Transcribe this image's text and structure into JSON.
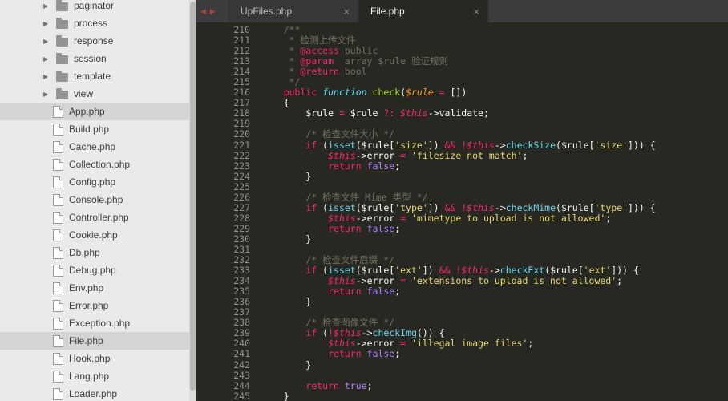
{
  "palette": {
    "editor_bg": "#272822",
    "sidebar_bg": "#eaeaea",
    "sidebar_selected_bg": "#d4d4d4",
    "tabbar_bg": "#3c3c3c",
    "comment": "#75715e",
    "keyword": "#f92672",
    "support_function": "#66d9ef",
    "function_name": "#a6e22e",
    "parameter": "#fd971f",
    "string": "#e6db74",
    "constant": "#ae81ff",
    "plain_text": "#f8f8f2",
    "line_number": "#90918b",
    "tab_arrow": "#a04848"
  },
  "icons": {
    "folder_chevron": "▶",
    "tab_prev": "◀",
    "tab_next": "▶",
    "tab_close": "×"
  },
  "sidebar": {
    "items": [
      {
        "type": "folder",
        "label": "paginator"
      },
      {
        "type": "folder",
        "label": "process"
      },
      {
        "type": "folder",
        "label": "response"
      },
      {
        "type": "folder",
        "label": "session"
      },
      {
        "type": "folder",
        "label": "template"
      },
      {
        "type": "folder",
        "label": "view"
      },
      {
        "type": "file",
        "label": "App.php",
        "selected": true
      },
      {
        "type": "file",
        "label": "Build.php"
      },
      {
        "type": "file",
        "label": "Cache.php"
      },
      {
        "type": "file",
        "label": "Collection.php"
      },
      {
        "type": "file",
        "label": "Config.php"
      },
      {
        "type": "file",
        "label": "Console.php"
      },
      {
        "type": "file",
        "label": "Controller.php"
      },
      {
        "type": "file",
        "label": "Cookie.php"
      },
      {
        "type": "file",
        "label": "Db.php"
      },
      {
        "type": "file",
        "label": "Debug.php"
      },
      {
        "type": "file",
        "label": "Env.php"
      },
      {
        "type": "file",
        "label": "Error.php"
      },
      {
        "type": "file",
        "label": "Exception.php"
      },
      {
        "type": "file",
        "label": "File.php",
        "selected": true
      },
      {
        "type": "file",
        "label": "Hook.php"
      },
      {
        "type": "file",
        "label": "Lang.php"
      },
      {
        "type": "file",
        "label": "Loader.php"
      }
    ]
  },
  "tabs": [
    {
      "label": "UpFiles.php",
      "active": false
    },
    {
      "label": "File.php",
      "active": true
    }
  ],
  "editor": {
    "first_line_number": 210,
    "last_line_number": 245,
    "lines": [
      {
        "n": 210,
        "t": [
          [
            "c",
            "    /**"
          ]
        ]
      },
      {
        "n": 211,
        "t": [
          [
            "c",
            "     * 检测上传文件"
          ]
        ]
      },
      {
        "n": 212,
        "t": [
          [
            "c",
            "     * "
          ],
          [
            "cd",
            "@access"
          ],
          [
            "c",
            " public"
          ]
        ]
      },
      {
        "n": 213,
        "t": [
          [
            "c",
            "     * "
          ],
          [
            "cd",
            "@param"
          ],
          [
            "c",
            "  array $rule 验证规则"
          ]
        ]
      },
      {
        "n": 214,
        "t": [
          [
            "c",
            "     * "
          ],
          [
            "cd",
            "@return"
          ],
          [
            "c",
            " bool"
          ]
        ]
      },
      {
        "n": 215,
        "t": [
          [
            "c",
            "     */"
          ]
        ]
      },
      {
        "n": 216,
        "t": [
          [
            "w",
            "    "
          ],
          [
            "k",
            "public"
          ],
          [
            "w",
            " "
          ],
          [
            "ki",
            "function"
          ],
          [
            "w",
            " "
          ],
          [
            "fn",
            "check"
          ],
          [
            "w",
            "("
          ],
          [
            "p",
            "$rule"
          ],
          [
            "o",
            " = "
          ],
          [
            "w",
            "[])"
          ]
        ]
      },
      {
        "n": 217,
        "t": [
          [
            "w",
            "    {"
          ]
        ]
      },
      {
        "n": 218,
        "t": [
          [
            "w",
            "        $rule"
          ],
          [
            "o",
            " = "
          ],
          [
            "w",
            "$rule"
          ],
          [
            "o",
            " ?: "
          ],
          [
            "th",
            "$this"
          ],
          [
            "w",
            "->validate;"
          ]
        ]
      },
      {
        "n": 219,
        "t": []
      },
      {
        "n": 220,
        "t": [
          [
            "c",
            "        /* 检查文件大小 */"
          ]
        ]
      },
      {
        "n": 221,
        "t": [
          [
            "w",
            "        "
          ],
          [
            "k",
            "if"
          ],
          [
            "w",
            " ("
          ],
          [
            "kc",
            "isset"
          ],
          [
            "w",
            "($rule["
          ],
          [
            "s",
            "'size'"
          ],
          [
            "w",
            "])"
          ],
          [
            "o",
            " && !"
          ],
          [
            "th",
            "$this"
          ],
          [
            "w",
            "->"
          ],
          [
            "m",
            "checkSize"
          ],
          [
            "w",
            "($rule["
          ],
          [
            "s",
            "'size'"
          ],
          [
            "w",
            "])) {"
          ]
        ]
      },
      {
        "n": 222,
        "t": [
          [
            "w",
            "            "
          ],
          [
            "th",
            "$this"
          ],
          [
            "w",
            "->error"
          ],
          [
            "o",
            " = "
          ],
          [
            "s",
            "'filesize not match'"
          ],
          [
            "w",
            ";"
          ]
        ]
      },
      {
        "n": 223,
        "t": [
          [
            "w",
            "            "
          ],
          [
            "k",
            "return"
          ],
          [
            "w",
            " "
          ],
          [
            "ct",
            "false"
          ],
          [
            "w",
            ";"
          ]
        ]
      },
      {
        "n": 224,
        "t": [
          [
            "w",
            "        }"
          ]
        ]
      },
      {
        "n": 225,
        "t": []
      },
      {
        "n": 226,
        "t": [
          [
            "c",
            "        /* 检查文件 Mime 类型 */"
          ]
        ]
      },
      {
        "n": 227,
        "t": [
          [
            "w",
            "        "
          ],
          [
            "k",
            "if"
          ],
          [
            "w",
            " ("
          ],
          [
            "kc",
            "isset"
          ],
          [
            "w",
            "($rule["
          ],
          [
            "s",
            "'type'"
          ],
          [
            "w",
            "])"
          ],
          [
            "o",
            " && !"
          ],
          [
            "th",
            "$this"
          ],
          [
            "w",
            "->"
          ],
          [
            "m",
            "checkMime"
          ],
          [
            "w",
            "($rule["
          ],
          [
            "s",
            "'type'"
          ],
          [
            "w",
            "])) {"
          ]
        ]
      },
      {
        "n": 228,
        "t": [
          [
            "w",
            "            "
          ],
          [
            "th",
            "$this"
          ],
          [
            "w",
            "->error"
          ],
          [
            "o",
            " = "
          ],
          [
            "s",
            "'mimetype to upload is not allowed'"
          ],
          [
            "w",
            ";"
          ]
        ]
      },
      {
        "n": 229,
        "t": [
          [
            "w",
            "            "
          ],
          [
            "k",
            "return"
          ],
          [
            "w",
            " "
          ],
          [
            "ct",
            "false"
          ],
          [
            "w",
            ";"
          ]
        ]
      },
      {
        "n": 230,
        "t": [
          [
            "w",
            "        }"
          ]
        ]
      },
      {
        "n": 231,
        "t": []
      },
      {
        "n": 232,
        "t": [
          [
            "c",
            "        /* 检查文件后缀 */"
          ]
        ]
      },
      {
        "n": 233,
        "t": [
          [
            "w",
            "        "
          ],
          [
            "k",
            "if"
          ],
          [
            "w",
            " ("
          ],
          [
            "kc",
            "isset"
          ],
          [
            "w",
            "($rule["
          ],
          [
            "s",
            "'ext'"
          ],
          [
            "w",
            "])"
          ],
          [
            "o",
            " && !"
          ],
          [
            "th",
            "$this"
          ],
          [
            "w",
            "->"
          ],
          [
            "m",
            "checkExt"
          ],
          [
            "w",
            "($rule["
          ],
          [
            "s",
            "'ext'"
          ],
          [
            "w",
            "])) {"
          ]
        ]
      },
      {
        "n": 234,
        "t": [
          [
            "w",
            "            "
          ],
          [
            "th",
            "$this"
          ],
          [
            "w",
            "->error"
          ],
          [
            "o",
            " = "
          ],
          [
            "s",
            "'extensions to upload is not allowed'"
          ],
          [
            "w",
            ";"
          ]
        ]
      },
      {
        "n": 235,
        "t": [
          [
            "w",
            "            "
          ],
          [
            "k",
            "return"
          ],
          [
            "w",
            " "
          ],
          [
            "ct",
            "false"
          ],
          [
            "w",
            ";"
          ]
        ]
      },
      {
        "n": 236,
        "t": [
          [
            "w",
            "        }"
          ]
        ]
      },
      {
        "n": 237,
        "t": []
      },
      {
        "n": 238,
        "t": [
          [
            "c",
            "        /* 检查图像文件 */"
          ]
        ]
      },
      {
        "n": 239,
        "t": [
          [
            "w",
            "        "
          ],
          [
            "k",
            "if"
          ],
          [
            "w",
            " ("
          ],
          [
            "o",
            "!"
          ],
          [
            "th",
            "$this"
          ],
          [
            "w",
            "->"
          ],
          [
            "m",
            "checkImg"
          ],
          [
            "w",
            "()) {"
          ]
        ]
      },
      {
        "n": 240,
        "t": [
          [
            "w",
            "            "
          ],
          [
            "th",
            "$this"
          ],
          [
            "w",
            "->error"
          ],
          [
            "o",
            " = "
          ],
          [
            "s",
            "'illegal image files'"
          ],
          [
            "w",
            ";"
          ]
        ]
      },
      {
        "n": 241,
        "t": [
          [
            "w",
            "            "
          ],
          [
            "k",
            "return"
          ],
          [
            "w",
            " "
          ],
          [
            "ct",
            "false"
          ],
          [
            "w",
            ";"
          ]
        ]
      },
      {
        "n": 242,
        "t": [
          [
            "w",
            "        }"
          ]
        ]
      },
      {
        "n": 243,
        "t": []
      },
      {
        "n": 244,
        "t": [
          [
            "w",
            "        "
          ],
          [
            "k",
            "return"
          ],
          [
            "w",
            " "
          ],
          [
            "ct",
            "true"
          ],
          [
            "w",
            ";"
          ]
        ]
      },
      {
        "n": 245,
        "t": [
          [
            "w",
            "    }"
          ]
        ]
      }
    ]
  }
}
